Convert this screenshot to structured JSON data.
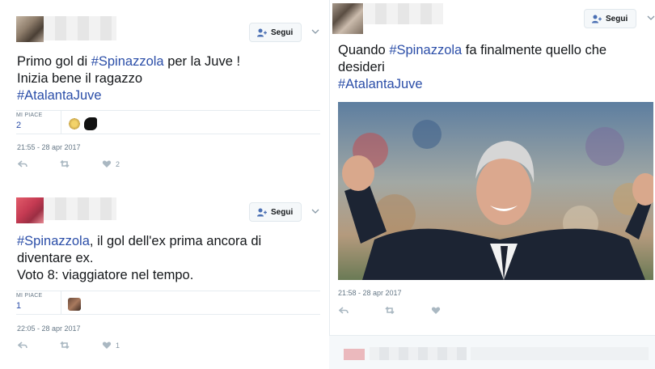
{
  "tweets": [
    {
      "follow_label": "Segui",
      "text_line1_a": "Primo gol di ",
      "text_line1_tag": "#Spinazzola",
      "text_line1_b": " per la Juve !",
      "text_line2": "Inizia bene il ragazzo",
      "text_line3_tag": "#AtalantaJuve",
      "likes_label": "MI PIACE",
      "likes_count": "2",
      "timestamp": "21:55 - 28 apr 2017",
      "like_action_count": "2"
    },
    {
      "follow_label": "Segui",
      "text_line1_tag": "#Spinazzola",
      "text_line1_b": ", il gol dell'ex prima ancora di",
      "text_line2": "diventare ex.",
      "text_line3": "Voto 8: viaggiatore nel tempo.",
      "likes_label": "MI PIACE",
      "likes_count": "1",
      "timestamp": "22:05 - 28 apr 2017",
      "like_action_count": "1"
    },
    {
      "follow_label": "Segui",
      "text_line1_a": "Quando ",
      "text_line1_tag": "#Spinazzola",
      "text_line1_b": " fa finalmente quello che",
      "text_line2": "desideri",
      "text_line3_tag": "#AtalantaJuve",
      "timestamp": "21:58 - 28 apr 2017"
    }
  ],
  "icons": {
    "follow": "add-user-icon",
    "reply": "reply-icon",
    "retweet": "retweet-icon",
    "like": "heart-icon",
    "more": "chevron-down-icon"
  },
  "colors": {
    "hashtag": "#2b4ea8",
    "meta": "#657786",
    "action": "#aab8c2"
  }
}
